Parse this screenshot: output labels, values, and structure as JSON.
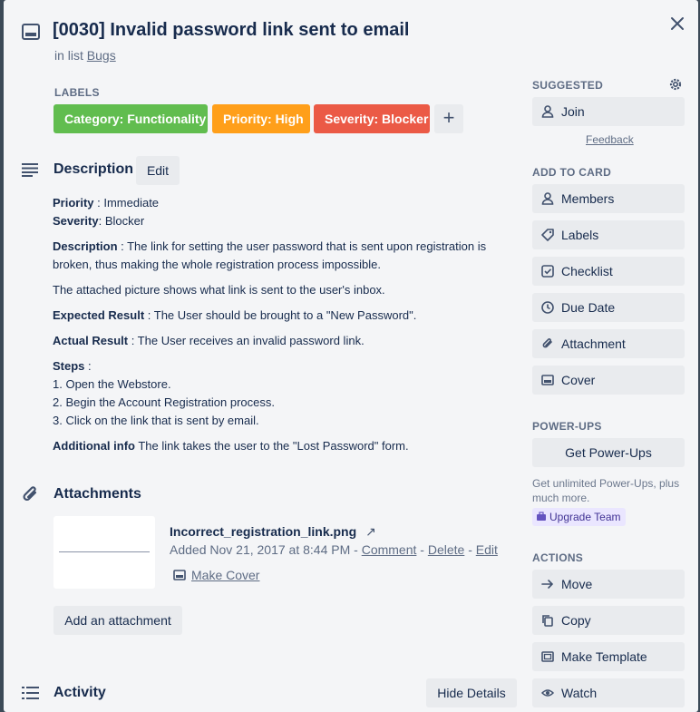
{
  "card": {
    "title": "[0030] Invalid password link sent to email",
    "in_list_prefix": "in list ",
    "list_name": "Bugs"
  },
  "labels": {
    "heading": "LABELS",
    "items": [
      {
        "text": "Category: Functionality",
        "color": "#61bd4f"
      },
      {
        "text": "Priority: High",
        "color": "#ff9f1a"
      },
      {
        "text": "Severity: Blocker",
        "color": "#eb5a46"
      }
    ],
    "add_symbol": "+"
  },
  "description": {
    "heading": "Description",
    "edit_label": "Edit",
    "priority_key": "Priority",
    "priority_val": " : Immediate",
    "severity_key": "Severity",
    "severity_val": ": Blocker",
    "desc_key": "Description",
    "desc_val": " : The link for setting the user password that is sent upon registration is broken, thus making the whole registration process impossible.",
    "attached_note": "The attached picture shows what link is sent to the user's inbox.",
    "expected_key": "Expected Result",
    "expected_val": " : The User should be brought to a \"New Password\".",
    "actual_key": "Actual Result",
    "actual_val": " : The User receives an invalid password link.",
    "steps_key": "Steps",
    "steps_val": " :",
    "step1": "1. Open the Webstore.",
    "step2": "2. Begin the Account Registration process.",
    "step3": "3. Click on the link that is sent by email.",
    "additional_key": "Additional info",
    "additional_val": " The link takes the user to the \"Lost Password\" form."
  },
  "attachments": {
    "heading": "Attachments",
    "file_name": "Incorrect_registration_link.png",
    "arrow": "↗",
    "added": "Added Nov 21, 2017 at 8:44 PM - ",
    "comment": "Comment",
    "sep1": " - ",
    "delete": "Delete",
    "sep2": " - ",
    "edit": "Edit",
    "make_cover": "Make Cover",
    "add_label": "Add an attachment"
  },
  "activity": {
    "heading": "Activity",
    "hide_details": "Hide Details"
  },
  "sidebar": {
    "suggested_heading": "SUGGESTED",
    "join": "Join",
    "feedback": "Feedback",
    "add_to_card_heading": "ADD TO CARD",
    "members": "Members",
    "labels": "Labels",
    "checklist": "Checklist",
    "due_date": "Due Date",
    "attachment": "Attachment",
    "cover": "Cover",
    "powerups_heading": "POWER-UPS",
    "get_powerups": "Get Power-Ups",
    "powerups_note": "Get unlimited Power-Ups, plus much more.",
    "upgrade_team": "Upgrade Team",
    "actions_heading": "ACTIONS",
    "move": "Move",
    "copy": "Copy",
    "make_template": "Make Template",
    "watch": "Watch"
  }
}
